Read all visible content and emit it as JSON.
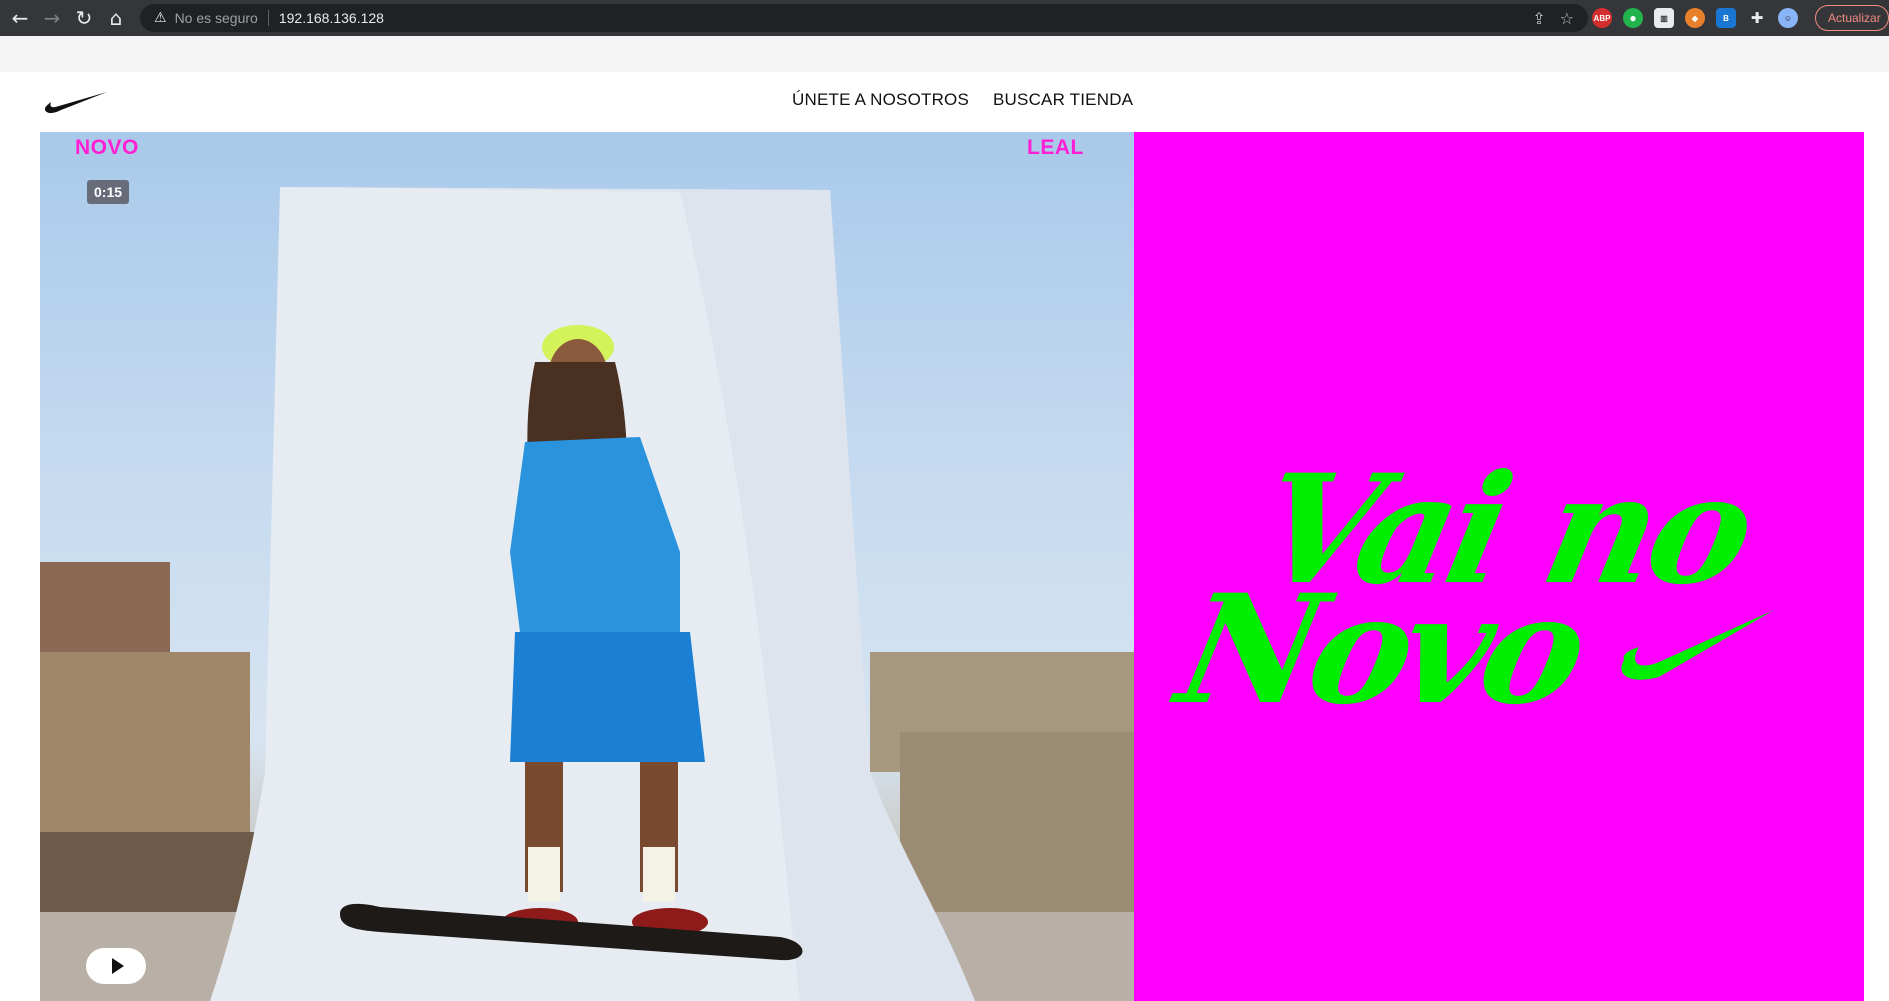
{
  "browser": {
    "security_label": "No es seguro",
    "url": "192.168.136.128",
    "update_label": "Actualizar",
    "extensions": [
      {
        "name": "adblock-plus-icon",
        "text": "ABP"
      },
      {
        "name": "green-extension-icon",
        "text": ""
      },
      {
        "name": "chart-extension-icon",
        "text": ""
      },
      {
        "name": "fox-extension-icon",
        "text": ""
      },
      {
        "name": "b-extension-icon",
        "text": ""
      }
    ]
  },
  "header": {
    "logo": "swoosh-logo",
    "nav": [
      {
        "label": "ÚNETE A NOSOTROS"
      },
      {
        "label": "BUSCAR TIENDA"
      }
    ]
  },
  "hero": {
    "video": {
      "label_left": "NOVO",
      "label_right": "LEAL",
      "duration": "0:15"
    },
    "promo": {
      "background": "#ff00ff",
      "text_color": "#00ee00",
      "headline_line1": "Vai no",
      "headline_line2": "Novo"
    }
  },
  "colors": {
    "accent_pink": "#ff1fd5",
    "chrome_dark": "#35363a"
  }
}
